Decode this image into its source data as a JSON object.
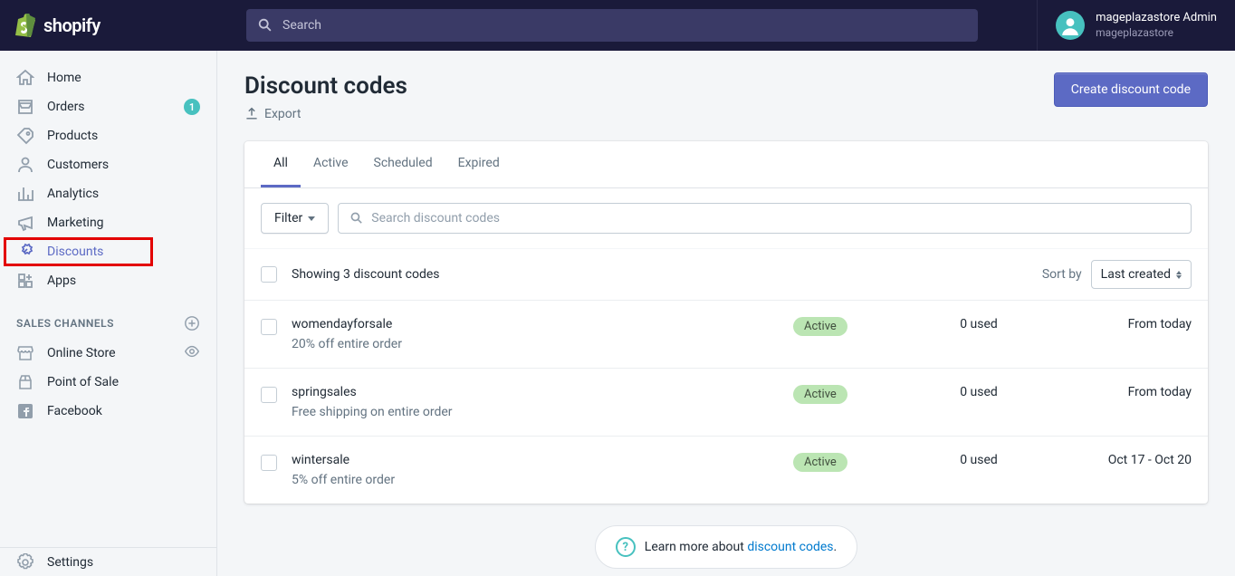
{
  "brand": "shopify",
  "search": {
    "placeholder": "Search"
  },
  "user": {
    "name": "mageplazastore Admin",
    "store": "mageplazastore"
  },
  "sidebar": {
    "items": [
      {
        "label": "Home"
      },
      {
        "label": "Orders",
        "badge": "1"
      },
      {
        "label": "Products"
      },
      {
        "label": "Customers"
      },
      {
        "label": "Analytics"
      },
      {
        "label": "Marketing"
      },
      {
        "label": "Discounts"
      },
      {
        "label": "Apps"
      }
    ],
    "section_label": "SALES CHANNELS",
    "channels": [
      {
        "label": "Online Store"
      },
      {
        "label": "Point of Sale"
      },
      {
        "label": "Facebook"
      }
    ],
    "settings": "Settings"
  },
  "page": {
    "title": "Discount codes",
    "export": "Export",
    "primary_button": "Create discount code"
  },
  "tabs": [
    "All",
    "Active",
    "Scheduled",
    "Expired"
  ],
  "filter": {
    "label": "Filter",
    "search_placeholder": "Search discount codes"
  },
  "list": {
    "showing": "Showing 3 discount codes",
    "sort_label": "Sort by",
    "sort_value": "Last created",
    "rows": [
      {
        "name": "womendayforsale",
        "desc": "20% off entire order",
        "status": "Active",
        "used": "0 used",
        "date": "From today"
      },
      {
        "name": "springsales",
        "desc": "Free shipping on entire order",
        "status": "Active",
        "used": "0 used",
        "date": "From today"
      },
      {
        "name": "wintersale",
        "desc": "5% off entire order",
        "status": "Active",
        "used": "0 used",
        "date": "Oct 17 - Oct 20"
      }
    ]
  },
  "learn": {
    "prefix": "Learn more about ",
    "link": "discount codes",
    "suffix": "."
  }
}
